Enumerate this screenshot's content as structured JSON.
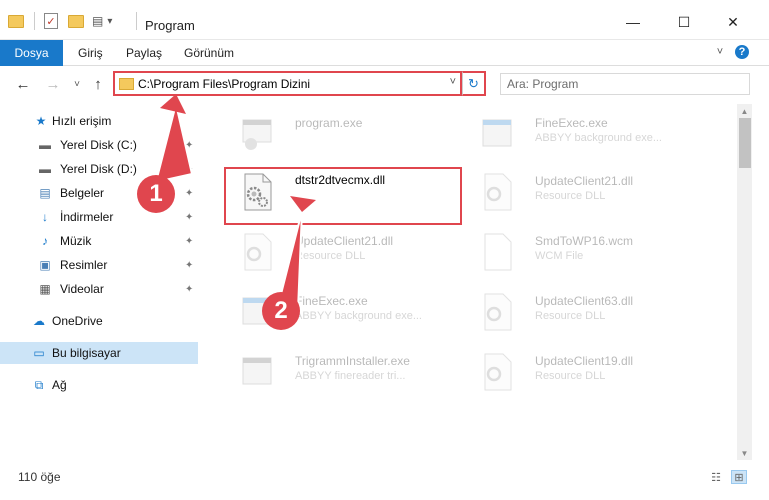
{
  "window": {
    "title": "Program",
    "minimize": "—",
    "maximize": "☐",
    "close": "✕"
  },
  "ribbon": {
    "tabs": [
      "Dosya",
      "Giriş",
      "Paylaş",
      "Görünüm"
    ],
    "expand": "˅",
    "help": "?"
  },
  "nav": {
    "back": "←",
    "forward": "→",
    "recent": "˅",
    "up": "↑",
    "address": "C:\\Program Files\\Program Dizini",
    "address_chevron": "˅",
    "refresh": "↻",
    "search_placeholder": "Ara: Program"
  },
  "sidebar": {
    "items": [
      {
        "label": "Hızlı erişim",
        "icon": "star-icon",
        "glyph": "★",
        "pinned": false
      },
      {
        "label": "Yerel Disk (C:)",
        "icon": "drive-icon",
        "glyph": "▬",
        "pinned": true
      },
      {
        "label": "Yerel Disk (D:)",
        "icon": "drive-icon",
        "glyph": "▬",
        "pinned": true
      },
      {
        "label": "Belgeler",
        "icon": "document-icon",
        "glyph": "▤",
        "pinned": true
      },
      {
        "label": "İndirmeler",
        "icon": "download-icon",
        "glyph": "↓",
        "pinned": true
      },
      {
        "label": "Müzik",
        "icon": "music-icon",
        "glyph": "♪",
        "pinned": true
      },
      {
        "label": "Resimler",
        "icon": "pictures-icon",
        "glyph": "▣",
        "pinned": true
      },
      {
        "label": "Videolar",
        "icon": "video-icon",
        "glyph": "▦",
        "pinned": true
      },
      {
        "label": "OneDrive",
        "icon": "cloud-icon",
        "glyph": "☁",
        "pinned": false
      },
      {
        "label": "Bu bilgisayar",
        "icon": "computer-icon",
        "glyph": "▭",
        "pinned": false
      },
      {
        "label": "Ağ",
        "icon": "network-icon",
        "glyph": "⧉",
        "pinned": false
      }
    ],
    "pin_glyph": "📌"
  },
  "files": [
    {
      "name": "program.exe",
      "desc": "",
      "faded": true
    },
    {
      "name": "FineExec.exe",
      "desc": "ABBYY background exe...",
      "faded": true
    },
    {
      "name": "dtstr2dtvecmx.dll",
      "desc": "",
      "faded": false
    },
    {
      "name": "UpdateClient21.dll",
      "desc": "Resource DLL",
      "faded": true
    },
    {
      "name": "UpdateClient21.dll",
      "desc": "Resource DLL",
      "faded": true
    },
    {
      "name": "SmdToWP16.wcm",
      "desc": "WCM File",
      "faded": true
    },
    {
      "name": "FineExec.exe",
      "desc": "ABBYY background exe...",
      "faded": true
    },
    {
      "name": "UpdateClient63.dll",
      "desc": "Resource DLL",
      "faded": true
    },
    {
      "name": "TrigrammInstaller.exe",
      "desc": "ABBYY finereader tri...",
      "faded": true
    },
    {
      "name": "UpdateClient19.dll",
      "desc": "Resource DLL",
      "faded": true
    }
  ],
  "status": {
    "count": "110 öğe",
    "details_view": "☷",
    "icons_view": "⊞"
  },
  "annotations": {
    "step1": "1",
    "step2": "2",
    "color": "#e0464e"
  },
  "colors": {
    "accent": "#1979ca",
    "highlight": "#e0464e",
    "selection": "#cce4f7"
  }
}
